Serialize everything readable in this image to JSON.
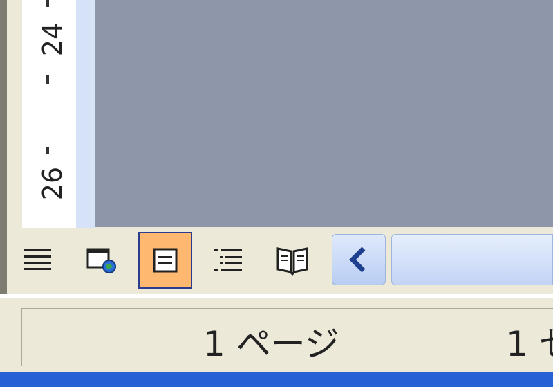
{
  "ruler": {
    "labels": [
      "24",
      "26"
    ]
  },
  "view_buttons": [
    {
      "id": "normal-view",
      "icon": "lines-icon",
      "active": false
    },
    {
      "id": "web-layout-view",
      "icon": "web-page-icon",
      "active": false
    },
    {
      "id": "print-layout-view",
      "icon": "page-layout-icon",
      "active": true
    },
    {
      "id": "outline-view",
      "icon": "outline-icon",
      "active": false
    },
    {
      "id": "reading-layout-view",
      "icon": "open-book-icon",
      "active": false
    }
  ],
  "status_bar": {
    "page": "1 ページ",
    "section": "1 セ"
  },
  "colors": {
    "active_button": "#ffb870",
    "active_border": "#2b3c8e",
    "doc_background": "#8e96aa",
    "taskbar": "#2761d6"
  }
}
